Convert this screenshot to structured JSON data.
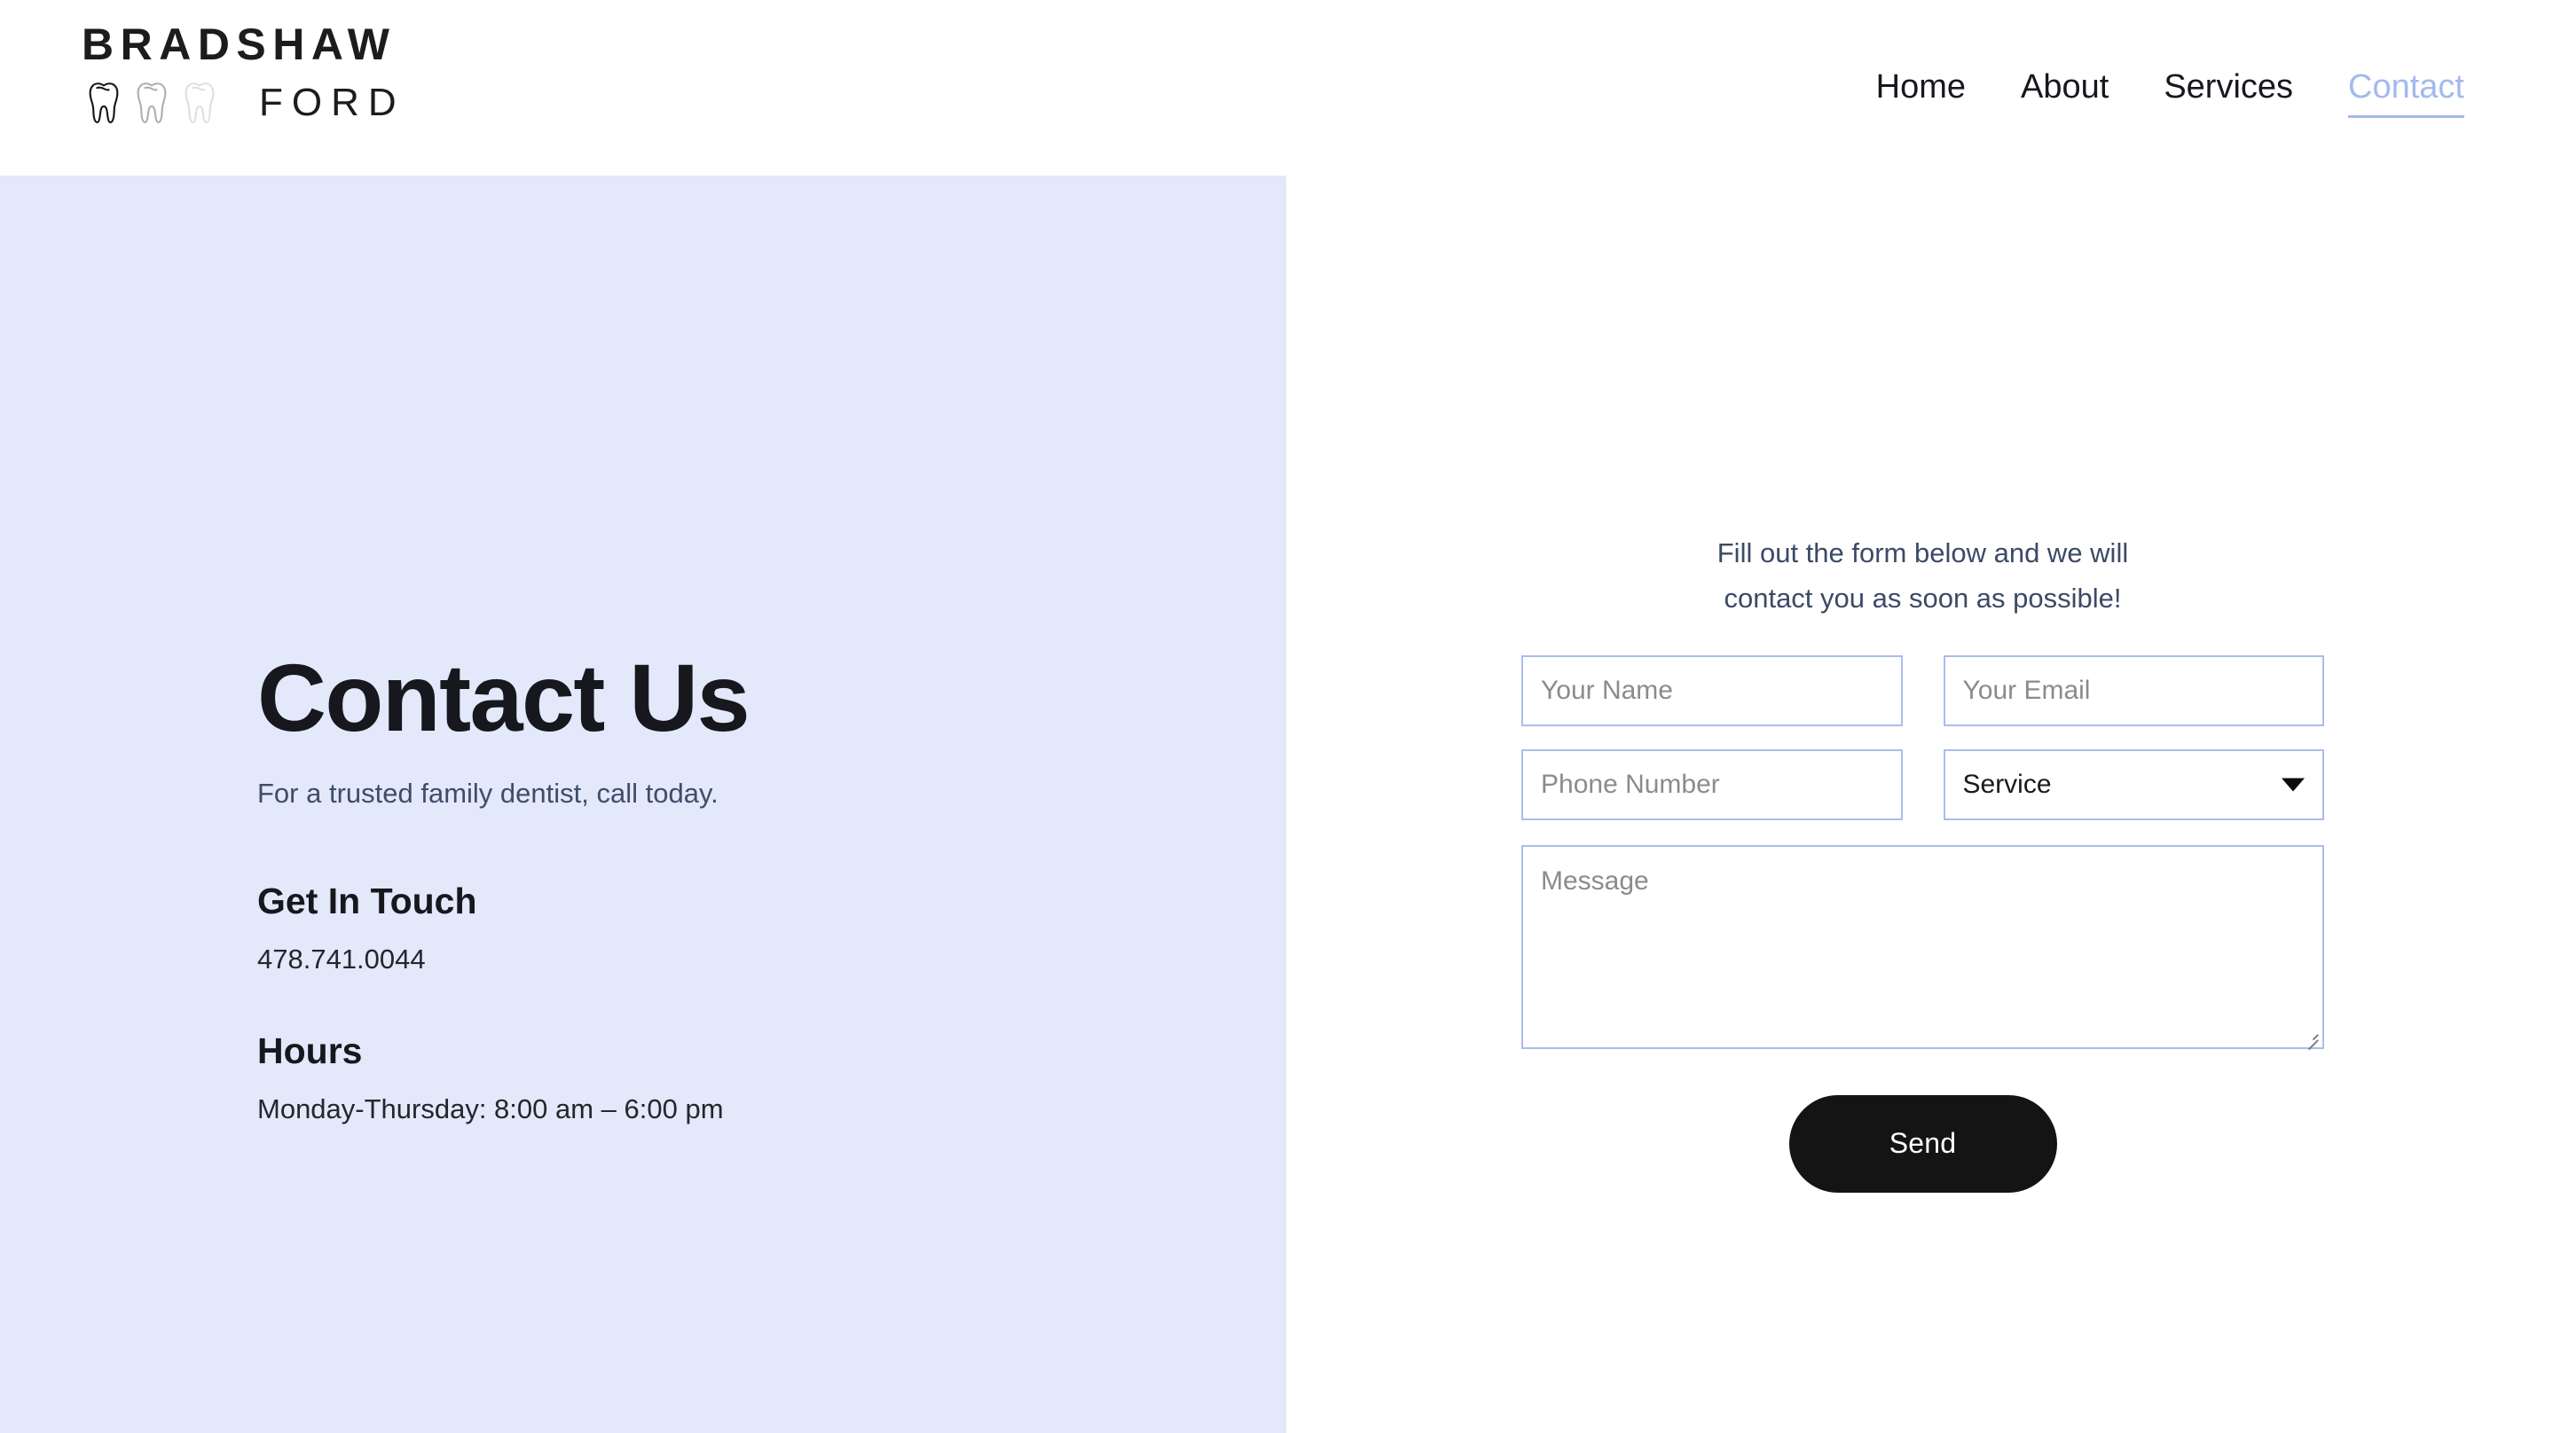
{
  "header": {
    "brand": {
      "name": "BRADSHAW",
      "sub": "FORD",
      "tooth_icons": [
        "tooth-icon-dark",
        "tooth-icon-medium",
        "tooth-icon-light"
      ]
    },
    "nav": [
      {
        "label": "Home",
        "active": false
      },
      {
        "label": "About",
        "active": false
      },
      {
        "label": "Services",
        "active": false
      },
      {
        "label": "Contact",
        "active": true
      }
    ]
  },
  "left": {
    "title": "Contact Us",
    "subtitle": "For a trusted family dentist, call today.",
    "blocks": [
      {
        "heading": "Get In Touch",
        "text": "478.741.0044"
      },
      {
        "heading": "Hours",
        "text": "Monday-Thursday: 8:00 am – 6:00 pm"
      }
    ]
  },
  "form": {
    "intro": "Fill out the form below and we will contact you as soon as possible!",
    "name_placeholder": "Your Name",
    "email_placeholder": "Your Email",
    "phone_placeholder": "Phone Number",
    "service_selected": "Service",
    "service_options": [
      "Service"
    ],
    "message_placeholder": "Message",
    "send_label": "Send"
  },
  "colors": {
    "panel_bg": "#e3e8fa",
    "accent": "#a4b9ee",
    "field_border": "#a9bdee",
    "ink": "#16181d",
    "slate_text": "#3c4a66",
    "button_bg": "#141414"
  }
}
